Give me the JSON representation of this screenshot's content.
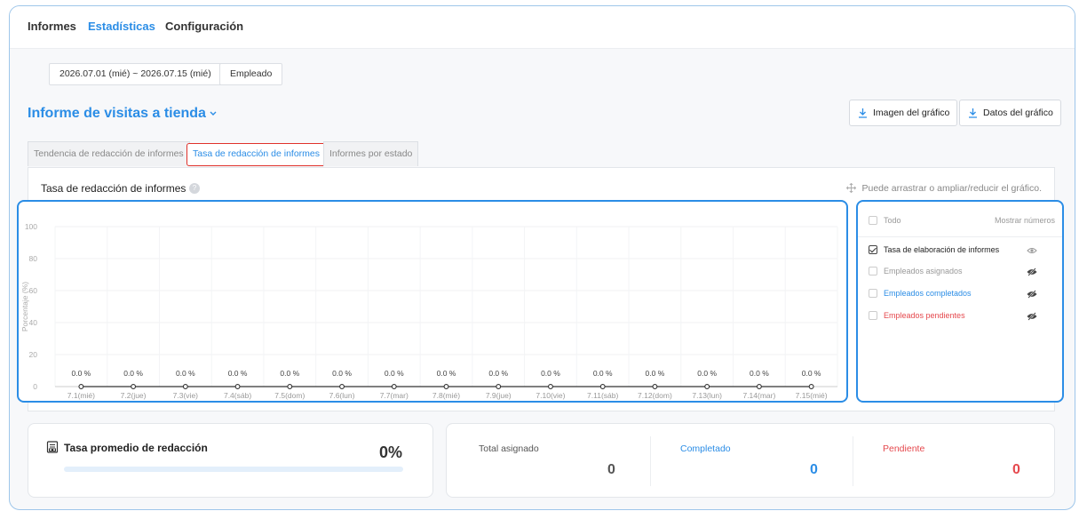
{
  "nav": {
    "items": [
      {
        "label": "Informes",
        "active": false
      },
      {
        "label": "Estadísticas",
        "active": true
      },
      {
        "label": "Configuración",
        "active": false
      }
    ]
  },
  "filters": {
    "date_range": "2026.07.01 (mié) ~ 2026.07.15 (mié)",
    "group": "Empleado"
  },
  "header": {
    "title": "Informe de visitas a tienda",
    "export_image": "Imagen del gráfico",
    "export_data": "Datos del gráfico"
  },
  "tabs": [
    {
      "label": "Tendencia de redacción de informes",
      "active": false
    },
    {
      "label": "Tasa de redacción de informes",
      "active": true
    },
    {
      "label": "Informes por estado",
      "active": false
    }
  ],
  "panel": {
    "title": "Tasa de redacción de informes",
    "hint": "Puede arrastrar o ampliar/reducir el gráfico."
  },
  "chart_data": {
    "type": "line",
    "title": "",
    "ylabel": "Porcentaje (%)",
    "ylim": [
      0,
      100
    ],
    "yticks": [
      0,
      20,
      40,
      60,
      80,
      100
    ],
    "categories": [
      "7.1(mié)",
      "7.2(jue)",
      "7.3(vie)",
      "7.4(sáb)",
      "7.5(dom)",
      "7.6(lun)",
      "7.7(mar)",
      "7.8(mié)",
      "7.9(jue)",
      "7.10(vie)",
      "7.11(sáb)",
      "7.12(dom)",
      "7.13(lun)",
      "7.14(mar)",
      "7.15(mié)"
    ],
    "series": [
      {
        "name": "Tasa de elaboración de informes",
        "values": [
          0,
          0,
          0,
          0,
          0,
          0,
          0,
          0,
          0,
          0,
          0,
          0,
          0,
          0,
          0
        ]
      }
    ],
    "data_labels": [
      "0.0 %",
      "0.0 %",
      "0.0 %",
      "0.0 %",
      "0.0 %",
      "0.0 %",
      "0.0 %",
      "0.0 %",
      "0.0 %",
      "0.0 %",
      "0.0 %",
      "0.0 %",
      "0.0 %",
      "0.0 %",
      "0.0 %"
    ],
    "grid": true,
    "line_color": "#333333"
  },
  "legend": {
    "all_label": "Todo",
    "show_numbers": "Mostrar números",
    "items": [
      {
        "label": "Tasa de elaboración de informes",
        "checked": true,
        "color": "#333333",
        "icon": "eye-icon"
      },
      {
        "label": "Empleados asignados",
        "checked": false,
        "color": "#999999",
        "icon": "eye-off-icon"
      },
      {
        "label": "Empleados completados",
        "checked": false,
        "color": "#2b8de6",
        "icon": "eye-off-icon"
      },
      {
        "label": "Empleados pendientes",
        "checked": false,
        "color": "#e5484d",
        "icon": "eye-off-icon"
      }
    ]
  },
  "summary": {
    "avg_title": "Tasa promedio de redacción",
    "avg_value": "0%",
    "avg_progress": 0,
    "stats": [
      {
        "label": "Total asignado",
        "value": "0",
        "color": "#555555"
      },
      {
        "label": "Completado",
        "value": "0",
        "color": "#2b8de6"
      },
      {
        "label": "Pendiente",
        "value": "0",
        "color": "#e5484d"
      }
    ]
  }
}
